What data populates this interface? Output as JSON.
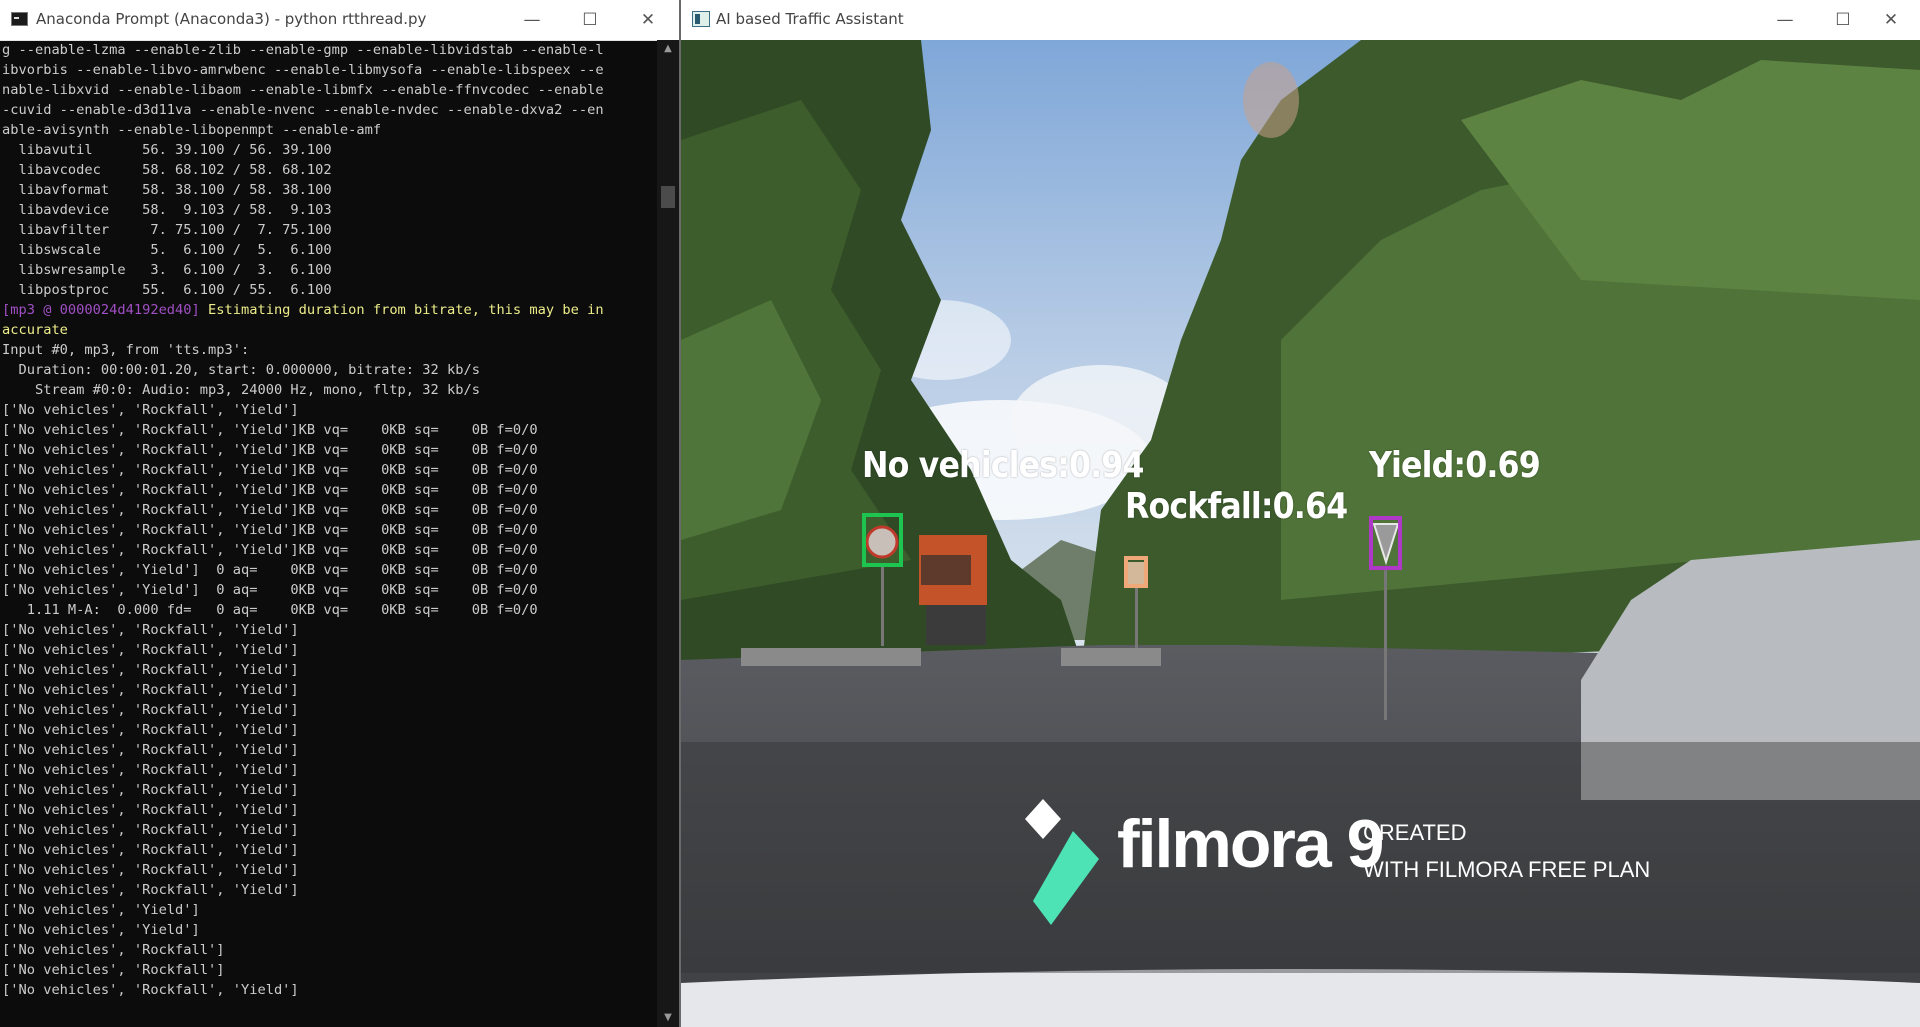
{
  "console_window": {
    "title": "Anaconda Prompt (Anaconda3) - python  rtthread.py",
    "lines_before": [
      "g --enable-lzma --enable-zlib --enable-gmp --enable-libvidstab --enable-l",
      "ibvorbis --enable-libvo-amrwbenc --enable-libmysofa --enable-libspeex --e",
      "nable-libxvid --enable-libaom --enable-libmfx --enable-ffnvcodec --enable",
      "-cuvid --enable-d3d11va --enable-nvenc --enable-nvdec --enable-dxva2 --en",
      "able-avisynth --enable-libopenmpt --enable-amf",
      "  libavutil      56. 39.100 / 56. 39.100",
      "  libavcodec     58. 68.102 / 58. 68.102",
      "  libavformat    58. 38.100 / 58. 38.100",
      "  libavdevice    58.  9.103 / 58.  9.103",
      "  libavfilter     7. 75.100 /  7. 75.100",
      "  libswscale      5.  6.100 /  5.  6.100",
      "  libswresample   3.  6.100 /  3.  6.100",
      "  libpostproc    55.  6.100 / 55.  6.100"
    ],
    "warning_tag": "[mp3 @ 0000024d4192ed40]",
    "warning_text": " Estimating duration from bitrate, this may be in",
    "warning_text_cont": "accurate",
    "lines_after": [
      "Input #0, mp3, from 'tts.mp3':",
      "  Duration: 00:00:01.20, start: 0.000000, bitrate: 32 kb/s",
      "    Stream #0:0: Audio: mp3, 24000 Hz, mono, fltp, 32 kb/s",
      "['No vehicles', 'Rockfall', 'Yield']",
      "['No vehicles', 'Rockfall', 'Yield']KB vq=    0KB sq=    0B f=0/0",
      "['No vehicles', 'Rockfall', 'Yield']KB vq=    0KB sq=    0B f=0/0",
      "['No vehicles', 'Rockfall', 'Yield']KB vq=    0KB sq=    0B f=0/0",
      "['No vehicles', 'Rockfall', 'Yield']KB vq=    0KB sq=    0B f=0/0",
      "['No vehicles', 'Rockfall', 'Yield']KB vq=    0KB sq=    0B f=0/0",
      "['No vehicles', 'Rockfall', 'Yield']KB vq=    0KB sq=    0B f=0/0",
      "['No vehicles', 'Rockfall', 'Yield']KB vq=    0KB sq=    0B f=0/0",
      "['No vehicles', 'Yield']  0 aq=    0KB vq=    0KB sq=    0B f=0/0",
      "['No vehicles', 'Yield']  0 aq=    0KB vq=    0KB sq=    0B f=0/0",
      "   1.11 M-A:  0.000 fd=   0 aq=    0KB vq=    0KB sq=    0B f=0/0",
      "['No vehicles', 'Rockfall', 'Yield']",
      "['No vehicles', 'Rockfall', 'Yield']",
      "['No vehicles', 'Rockfall', 'Yield']",
      "['No vehicles', 'Rockfall', 'Yield']",
      "['No vehicles', 'Rockfall', 'Yield']",
      "['No vehicles', 'Rockfall', 'Yield']",
      "['No vehicles', 'Rockfall', 'Yield']",
      "['No vehicles', 'Rockfall', 'Yield']",
      "['No vehicles', 'Rockfall', 'Yield']",
      "['No vehicles', 'Rockfall', 'Yield']",
      "['No vehicles', 'Rockfall', 'Yield']",
      "['No vehicles', 'Rockfall', 'Yield']",
      "['No vehicles', 'Rockfall', 'Yield']",
      "['No vehicles', 'Rockfall', 'Yield']",
      "['No vehicles', 'Yield']",
      "['No vehicles', 'Yield']",
      "['No vehicles', 'Rockfall']",
      "['No vehicles', 'Rockfall']",
      "['No vehicles', 'Rockfall', 'Yield']"
    ]
  },
  "video_window": {
    "title": "AI based Traffic Assistant",
    "detections": [
      {
        "label": "No vehicles:0.94",
        "color": "#1ec450"
      },
      {
        "label": "Rockfall:0.64",
        "color": "#f0a878"
      },
      {
        "label": "Yield:0.69",
        "color": "#b038c8"
      }
    ],
    "watermark": {
      "brand": "filmora 9",
      "line1": "CREATED",
      "line2": "WITH FILMORA FREE PLAN",
      "logo_color": "#4de3b4"
    }
  },
  "window_controls": {
    "minimize": "—",
    "maximize": "☐",
    "close": "✕"
  }
}
